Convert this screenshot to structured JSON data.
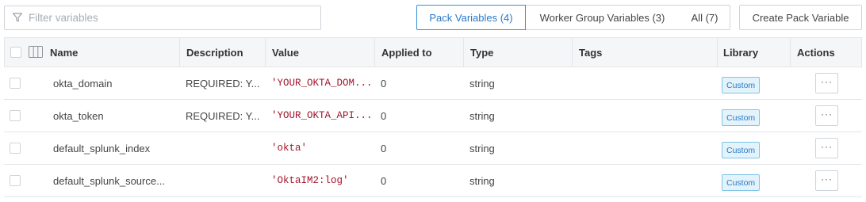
{
  "filter": {
    "placeholder": "Filter variables"
  },
  "tabs": [
    {
      "label": "Pack Variables (4)"
    },
    {
      "label": "Worker Group Variables (3)"
    },
    {
      "label": "All (7)"
    }
  ],
  "create_label": "Create Pack Variable",
  "columns": {
    "name": "Name",
    "description": "Description",
    "value": "Value",
    "applied_to": "Applied to",
    "type": "Type",
    "tags": "Tags",
    "library": "Library",
    "actions": "Actions"
  },
  "rows": [
    {
      "name": "okta_domain",
      "description": "REQUIRED: Y...",
      "value": "'YOUR_OKTA_DOM...",
      "applied_to": "0",
      "type": "string",
      "tags": "",
      "library": "Custom",
      "actions": "···"
    },
    {
      "name": "okta_token",
      "description": "REQUIRED: Y...",
      "value": "'YOUR_OKTA_API...",
      "applied_to": "0",
      "type": "string",
      "tags": "",
      "library": "Custom",
      "actions": "···"
    },
    {
      "name": "default_splunk_index",
      "description": "",
      "value": "'okta'",
      "applied_to": "0",
      "type": "string",
      "tags": "",
      "library": "Custom",
      "actions": "···"
    },
    {
      "name": "default_splunk_source...",
      "description": "",
      "value": "'OktaIM2:log'",
      "applied_to": "0",
      "type": "string",
      "tags": "",
      "library": "Custom",
      "actions": "···"
    }
  ],
  "colors": {
    "accent": "#2a79c8",
    "value_text": "#a3142a",
    "badge_bg": "#e3f3fb"
  },
  "icons": {
    "filter": "filter-icon",
    "columns": "columns-icon",
    "more": "more-icon"
  }
}
